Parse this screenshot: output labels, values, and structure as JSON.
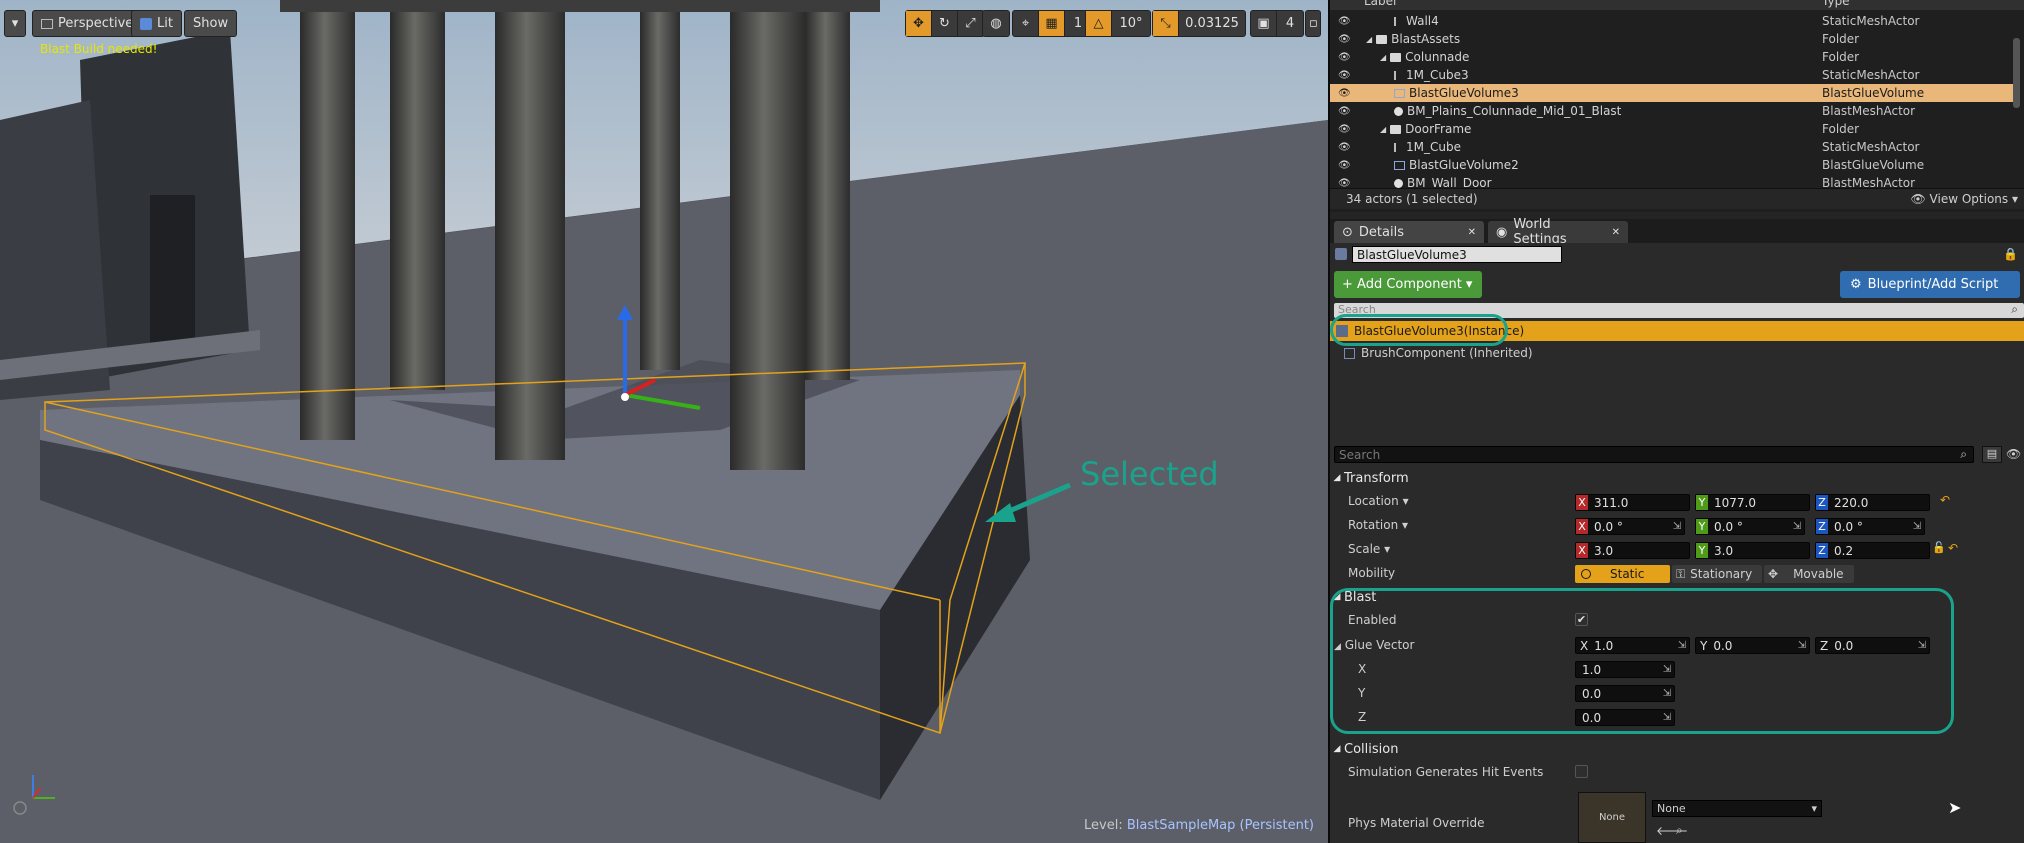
{
  "viewport": {
    "perspective_label": "Perspective",
    "lit_label": "Lit",
    "show_label": "Show",
    "warning": "Blast Build needed!",
    "grid_snap": "10",
    "rotation_snap": "10°",
    "scale_snap": "0.03125",
    "camera_speed": "4",
    "layer_count": "1",
    "level_prefix": "Level:",
    "level_name": "BlastSampleMap (Persistent)",
    "annotation": "Selected",
    "colors": {
      "selection": "#e3a21a",
      "annotation": "#1aa38c"
    }
  },
  "outliner": {
    "header_label": "Label",
    "header_type": "Type",
    "rows": [
      {
        "label": "Wall4",
        "type": "StaticMeshActor",
        "indent": 3,
        "icon": "mesh-icon"
      },
      {
        "label": "BlastAssets",
        "type": "Folder",
        "indent": 1,
        "icon": "folder-icon"
      },
      {
        "label": "Colunnade",
        "type": "Folder",
        "indent": 2,
        "icon": "folder-icon"
      },
      {
        "label": "1M_Cube3",
        "type": "StaticMeshActor",
        "indent": 3,
        "icon": "mesh-icon"
      },
      {
        "label": "BlastGlueVolume3",
        "type": "BlastGlueVolume",
        "indent": 3,
        "icon": "volume-icon",
        "selected": true
      },
      {
        "label": "BM_Plains_Colunnade_Mid_01_Blast",
        "type": "BlastMeshActor",
        "indent": 3,
        "icon": "sphere-icon"
      },
      {
        "label": "DoorFrame",
        "type": "Folder",
        "indent": 2,
        "icon": "folder-icon"
      },
      {
        "label": "1M_Cube",
        "type": "StaticMeshActor",
        "indent": 3,
        "icon": "mesh-icon"
      },
      {
        "label": "BlastGlueVolume2",
        "type": "BlastGlueVolume",
        "indent": 3,
        "icon": "volume-icon"
      },
      {
        "label": "BM_Wall_Door",
        "type": "BlastMeshActor",
        "indent": 3,
        "icon": "sphere-icon"
      }
    ],
    "actor_count": "34 actors (1 selected)",
    "view_options": "View Options"
  },
  "details": {
    "tab_details": "Details",
    "tab_world": "World Settings",
    "actor_name": "BlastGlueVolume3",
    "add_component": "+ Add Component",
    "blueprint": "Blueprint/Add Script",
    "search_placeholder": "Search",
    "components": [
      "BlastGlueVolume3(Instance)",
      "BrushComponent (Inherited)"
    ],
    "search2_placeholder": "Search",
    "transform": {
      "title": "Transform",
      "location_label": "Location",
      "rotation_label": "Rotation",
      "scale_label": "Scale",
      "mobility_label": "Mobility",
      "location": [
        "311.0",
        "1077.0",
        "220.0"
      ],
      "rotation": [
        "0.0 °",
        "0.0 °",
        "0.0 °"
      ],
      "scale": [
        "3.0",
        "3.0",
        "0.2"
      ],
      "mobility": [
        "Static",
        "Stationary",
        "Movable"
      ]
    },
    "blast": {
      "title": "Blast",
      "enabled_label": "Enabled",
      "enabled": true,
      "glue_label": "Glue Vector",
      "glue": [
        "1.0",
        "0.0",
        "0.0"
      ],
      "x_label": "X",
      "y_label": "Y",
      "z_label": "Z"
    },
    "collision": {
      "title": "Collision",
      "sim_label": "Simulation Generates Hit Events",
      "sim": false,
      "phys_label": "Phys Material Override",
      "phys_thumb": "None",
      "phys_value": "None"
    }
  }
}
